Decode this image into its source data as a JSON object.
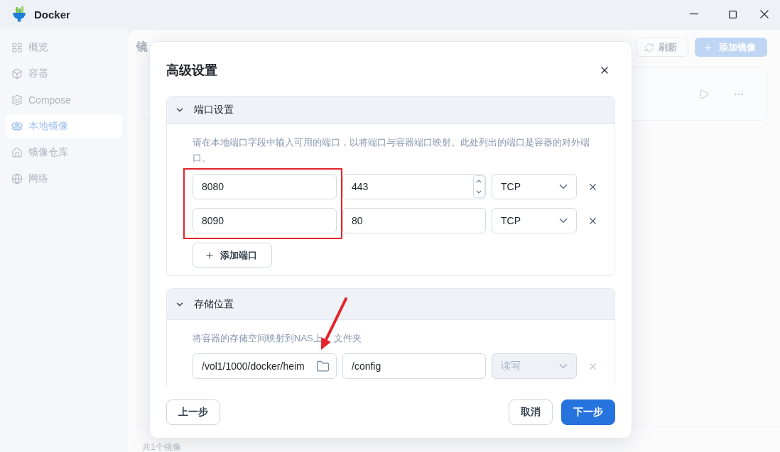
{
  "window": {
    "title": "Docker"
  },
  "sidebar": {
    "items": [
      {
        "label": "概览",
        "selected": false
      },
      {
        "label": "容器",
        "selected": false
      },
      {
        "label": "Compose",
        "selected": false
      },
      {
        "label": "本地镜像",
        "selected": true
      },
      {
        "label": "镜像仓库",
        "selected": false
      },
      {
        "label": "网络",
        "selected": false
      }
    ]
  },
  "page": {
    "title": "镜",
    "toolbar": {
      "refresh": "刷新",
      "add": "添加镜像"
    },
    "status": "共1个镜像"
  },
  "dialog": {
    "title": "高级设置",
    "ports": {
      "title": "端口设置",
      "expanded": true,
      "description": "请在本地端口字段中输入可用的端口，以将端口与容器端口映射。此处列出的端口是容器的对外端口。",
      "highlight_local_ports": true,
      "rows": [
        {
          "local_port": "8080",
          "container_port": "443",
          "container_port_focused": true,
          "protocol": "TCP"
        },
        {
          "local_port": "8090",
          "container_port": "80",
          "container_port_focused": false,
          "protocol": "TCP"
        }
      ],
      "add_button": "添加端口"
    },
    "storage": {
      "title": "存储位置",
      "expanded": true,
      "description": [
        "将容器的存储空间映射到NAS上",
        "文件夹"
      ],
      "rows": [
        {
          "host_path": "/vol1/1000/docker/heim",
          "container_path": "/config",
          "permission": "读写",
          "disabled": true,
          "arrow_to_folder": true
        }
      ]
    },
    "footer": {
      "left": [
        {
          "label": "上一步",
          "kind": "secondary"
        }
      ],
      "right": [
        {
          "label": "取消",
          "kind": "secondary"
        },
        {
          "label": "下一步",
          "kind": "primary"
        }
      ]
    }
  }
}
